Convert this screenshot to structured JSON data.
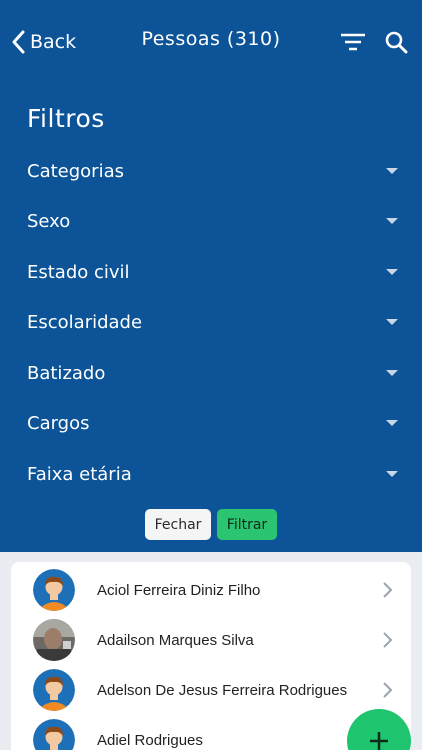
{
  "header": {
    "back_label": "Back",
    "title": "Pessoas (310)"
  },
  "filters": {
    "title": "Filtros",
    "items": [
      "Categorias",
      "Sexo",
      "Estado civil",
      "Escolaridade",
      "Batizado",
      "Cargos",
      "Faixa etária"
    ],
    "close_label": "Fechar",
    "apply_label": "Filtrar"
  },
  "people": [
    {
      "name": "Aciol Ferreira Diniz Filho",
      "avatar": "default-avatar"
    },
    {
      "name": "Adailson Marques Silva",
      "avatar": "photo-avatar"
    },
    {
      "name": "Adelson De Jesus Ferreira Rodrigues",
      "avatar": "default-avatar"
    },
    {
      "name": "Adiel Rodrigues",
      "avatar": "default-avatar"
    }
  ],
  "colors": {
    "header_bg": "#0c5497",
    "accent_green": "#2bc571",
    "avatar_bg": "#1d6fb8",
    "avatar_shirt": "#f08a24"
  }
}
